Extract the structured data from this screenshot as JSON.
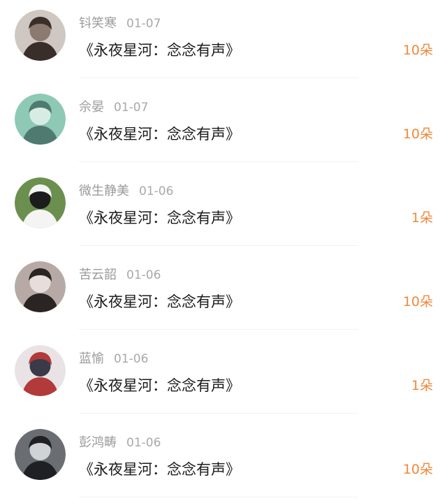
{
  "gift_list": [
    {
      "name": "钭笑寒",
      "date": "01-07",
      "title": "《永夜星河：念念有声》",
      "count": "10朵",
      "avatar_colors": [
        "#cfc8c2",
        "#3a2e2a",
        "#8a7a70"
      ]
    },
    {
      "name": "佘晏",
      "date": "01-07",
      "title": "《永夜星河：念念有声》",
      "count": "10朵",
      "avatar_colors": [
        "#8ec9b6",
        "#4f7a70",
        "#d8ece6"
      ]
    },
    {
      "name": "微生静美",
      "date": "01-06",
      "title": "《永夜星河：念念有声》",
      "count": "1朵",
      "avatar_colors": [
        "#6b8f4e",
        "#f4f4f2",
        "#1c1c1c"
      ]
    },
    {
      "name": "苦云韶",
      "date": "01-06",
      "title": "《永夜星河：念念有声》",
      "count": "10朵",
      "avatar_colors": [
        "#b7aaa6",
        "#2a2422",
        "#e7dedb"
      ]
    },
    {
      "name": "蓝愉",
      "date": "01-06",
      "title": "《永夜星河：念念有声》",
      "count": "1朵",
      "avatar_colors": [
        "#e9e3e6",
        "#b23a3a",
        "#3a3a48"
      ]
    },
    {
      "name": "彭鸿畴",
      "date": "01-06",
      "title": "《永夜星河：念念有声》",
      "count": "10朵",
      "avatar_colors": [
        "#6a6e72",
        "#1e2023",
        "#cfd3d6"
      ]
    }
  ]
}
